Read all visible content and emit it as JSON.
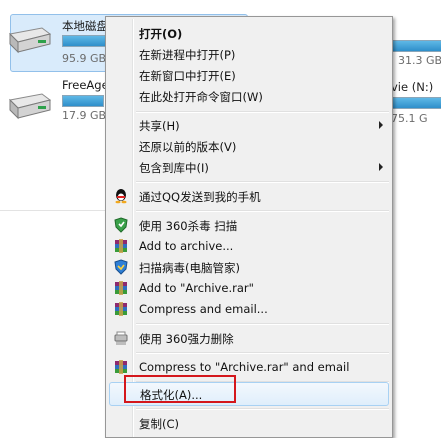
{
  "drives": [
    {
      "name": "本地磁盘",
      "size": "95.9 GB",
      "fill": 0.55
    },
    {
      "name": "FreeAge",
      "size": "17.9 GB",
      "fill": 0.85
    }
  ],
  "right_drive": {
    "name": "vie (N:)",
    "size": "75.1 G"
  },
  "right_partial_size": "31.3 GB",
  "context_menu": {
    "open": "打开(O)",
    "open_new_process": "在新进程中打开(P)",
    "open_new_window": "在新窗口中打开(E)",
    "open_cmd": "在此处打开命令窗口(W)",
    "share": "共享(H)",
    "restore_prev": "还原以前的版本(V)",
    "include_library": "包含到库中(I)",
    "send_qq": "通过QQ发送到我的手机",
    "scan_360": "使用 360杀毒 扫描",
    "add_archive": "Add to archive...",
    "scan_pcmgr": "扫描病毒(电脑管家)",
    "add_rar": "Add to \"Archive.rar\"",
    "compress_email": "Compress and email...",
    "force_delete_360": "使用 360强力删除",
    "compress_rar_email": "Compress to \"Archive.rar\" and email",
    "format": "格式化(A)...",
    "copy": "复制(C)"
  }
}
